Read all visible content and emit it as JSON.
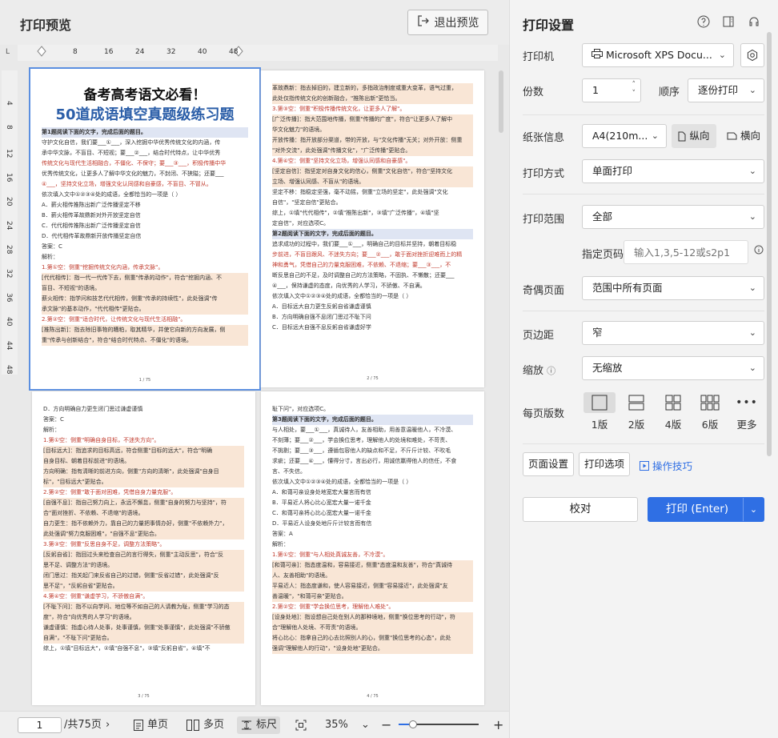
{
  "preview": {
    "title": "打印预览",
    "exit_label": "退出预览",
    "ruler_h": [
      "8",
      "16",
      "24",
      "32",
      "40",
      "48"
    ],
    "ruler_v": [
      "4",
      "8",
      "12",
      "16",
      "20",
      "24",
      "28",
      "32",
      "36",
      "40",
      "44",
      "48"
    ],
    "corner": "L",
    "page1": {
      "title1": "备考高考语文必看！",
      "title2": "50道成语填空真题级练习题",
      "lines": [
        {
          "t": "第1题阅读下面的文字，完成后面的题目。",
          "c": "b"
        },
        {
          "t": "守护文化自信，我们要___①___，深入挖掘中华优秀传统文化的内涵，传",
          "c": ""
        },
        {
          "t": "承中华文脉，不盲目、不短视；要___②___，结合时代特点，让中华优秀",
          "c": ""
        },
        {
          "t": "传统文化与现代生活相融合，不僵化、不保守；要___③___，积极传播中华",
          "c": "r"
        },
        {
          "t": "优秀传统文化，让更多人了解中华文化的魅力，不封闭、不狭隘；还要___",
          "c": ""
        },
        {
          "t": "④___，坚持文化立场，增强文化认同感和自豪感，不盲目、不冒从。",
          "c": "r"
        },
        {
          "t": "依次填入文中①②③④处的成语，全都恰当的一项是（ ）",
          "c": ""
        },
        {
          "t": "A．薪火相传推陈出新广泛传播坚定不移",
          "c": ""
        },
        {
          "t": "B．薪火相传革故鼎新对外开放坚定自信",
          "c": ""
        },
        {
          "t": "C．代代相传推陈出新广泛传播坚定自信",
          "c": ""
        },
        {
          "t": "D．代代相传革故鼎新开放传播坚定自信",
          "c": ""
        },
        {
          "t": "答案：C",
          "c": ""
        },
        {
          "t": "解析：",
          "c": ""
        },
        {
          "t": "1.第①空：侧重\"挖掘传统文化内涵，传承文脉\"。",
          "c": "r"
        },
        {
          "t": "[代代相传]：指一代一代传下去，侧重\"传承的动作\"，符合\"挖掘内涵、不",
          "c": "h"
        },
        {
          "t": "盲目、不短视\"的语境。",
          "c": "h"
        },
        {
          "t": "薪火相传：指学问和技艺代代相传，侧重\"传承的持续性\"，此处强调\"传",
          "c": "h"
        },
        {
          "t": "承文脉\"的基本动作，\"代代相传\"更贴合。",
          "c": "h"
        },
        {
          "t": "2.第②空：侧重\"适合时代，让传统文化与现代生活相融\"。",
          "c": "r"
        },
        {
          "t": "[推陈出新]：指去除旧事物的糟粕，取其精华，并使它向新的方向发展，侧",
          "c": "h"
        },
        {
          "t": "重\"传承与创新结合\"，符合\"结合时代特点、不僵化\"的语境。",
          "c": "h"
        }
      ],
      "pnum": "1 / 75"
    },
    "page2": {
      "lines": [
        {
          "t": "革故鼎新：指去掉旧的，建立新的，多指政治制度或重大变革，语气过重，",
          "c": "h"
        },
        {
          "t": "此处仅指传统文化的创新融合，\"推陈出新\"更恰当。",
          "c": "h"
        },
        {
          "t": "3.第③空：侧重\"积极传播传统文化，让更多人了解\"。",
          "c": "r"
        },
        {
          "t": "[广泛传播]：指大范围地传播，侧重\"传播的广度\"，符合\"让更多人了解中",
          "c": "h"
        },
        {
          "t": "华文化魅力\"的语境。",
          "c": "h"
        },
        {
          "t": "开放传播：指开放部分渠道，带的开放，与\"文化传播\"无关；对外开放：侧重",
          "c": "h"
        },
        {
          "t": "\"对外交流\"，此处强调\"传播文化\"，\"广泛传播\"更贴合。",
          "c": "h"
        },
        {
          "t": "4.第④空：侧重\"坚持文化立场，增强认同感和自豪感\"。",
          "c": "r"
        },
        {
          "t": "[坚定自信]：指坚定对自身文化的信心，侧重\"文化自信\"，符合\"坚持文化",
          "c": "h"
        },
        {
          "t": "立场、增强认同感、不盲从\"的语境。",
          "c": "h"
        },
        {
          "t": "坚定不移：指稳定坚强，毫不动摇，侧重\"立场的坚定\"，此处强调\"文化",
          "c": ""
        },
        {
          "t": "自信\"，\"坚定自信\"更贴合。",
          "c": ""
        },
        {
          "t": "综上，①填\"代代相传\"，②填\"推陈出新\"，③填\"广泛传播\"，④填\"坚",
          "c": ""
        },
        {
          "t": "定自信\"，对应选项C。",
          "c": ""
        },
        {
          "t": "第2题阅读下面的文字，完成后面的题目。",
          "c": "b"
        },
        {
          "t": "追求成功的过程中，我们要___①___，明确自己的目标并坚持，朝着目标稳",
          "c": ""
        },
        {
          "t": "步前进，不盲目跟风、不迷失方向；要___②___，敢于面对挫折迎难而上的精",
          "c": "r"
        },
        {
          "t": "神和勇气，凭借自己的力量克服困难，不依赖、不退缩；要___③___，不",
          "c": "r"
        },
        {
          "t": "断反思自己的不足，及时调整自己的方法策略，不固执、不懒散；还要___",
          "c": ""
        },
        {
          "t": "④___，保持谦虚的态度，向优秀的人学习，不骄傲、不自满。",
          "c": ""
        },
        {
          "t": "依次填入文中①②③④处的成语，全都恰当的一项是（ ）",
          "c": ""
        },
        {
          "t": "A．目标远大自力更生反躬自省谦虚谨慎",
          "c": ""
        },
        {
          "t": "B．方向明确自强不息闭门思过不耻下问",
          "c": ""
        },
        {
          "t": "C．目标远大自强不息反躬自省谦虚好学",
          "c": ""
        }
      ],
      "pnum": "2 / 75"
    },
    "page3": {
      "lines": [
        {
          "t": "D．方向明确自力更生闭门思过谦虚谨慎",
          "c": ""
        },
        {
          "t": "答案：C",
          "c": ""
        },
        {
          "t": "解析：",
          "c": ""
        },
        {
          "t": "1.第①空：侧重\"明确自身目标，不迷失方向\"。",
          "c": "r"
        },
        {
          "t": "[目标远大]：指追求的目标高远，符合侧重\"目标的远大\"，符合\"明确",
          "c": "h"
        },
        {
          "t": "自身目标、朝着目标前进\"的语境。",
          "c": "h"
        },
        {
          "t": "方向明确：指有清晰的前进方向，侧重\"方向的清晰\"，此处强调\"自身目",
          "c": "h"
        },
        {
          "t": "标\"，\"目标远大\"更贴合。",
          "c": "h"
        },
        {
          "t": "2.第②空：侧重\"敢于面对困难，凭借自身力量克服\"。",
          "c": "r"
        },
        {
          "t": "[自强不息]：指自己努力向上，永远不懈怠，侧重\"自身的努力与坚持\"，符",
          "c": "h"
        },
        {
          "t": "合\"面对挫折、不依赖、不退缩\"的语境。",
          "c": "h"
        },
        {
          "t": "自力更生：指不依赖外力，靠自己的力量把事情办好，侧重\"不依赖外力\"，",
          "c": "h"
        },
        {
          "t": "此处强调\"努力克服困难\"，\"自强不息\"更贴合。",
          "c": "h"
        },
        {
          "t": "3.第③空：侧重\"反思自身不足，调整方法策略\"。",
          "c": "r"
        },
        {
          "t": "[反躬自省]：指回过头来检查自己的言行得失，侧重\"主动反思\"，符合\"反",
          "c": "h"
        },
        {
          "t": "思不足、调整方法\"的语境。",
          "c": "h"
        },
        {
          "t": "闭门思过：指关起门来反省自己的过错，侧重\"反省过错\"，此处强调\"反",
          "c": "h"
        },
        {
          "t": "思不足\"，\"反躬自省\"更贴合。",
          "c": "h"
        },
        {
          "t": "4.第④空：侧重\"谦虚学习，不骄傲自满\"。",
          "c": "r"
        },
        {
          "t": "[不耻下问]：指不以向学问、地位等不如自己的人请教为耻，侧重\"学习的态",
          "c": "h"
        },
        {
          "t": "度\"，符合\"向优秀的人学习\"的语境。",
          "c": "h"
        },
        {
          "t": "谦虚谨慎：指虚心待人处事，处事谨慎，侧重\"处事谨慎\"，此处强调\"不骄傲",
          "c": "h"
        },
        {
          "t": "自满\"，\"不耻下问\"更贴合。",
          "c": "h"
        },
        {
          "t": "综上，①填\"目标远大\"，②填\"自强不息\"，③填\"反躬自省\"，④填\"不",
          "c": ""
        }
      ],
      "pnum": "3 / 75"
    },
    "page4": {
      "lines": [
        {
          "t": "耻下问\"，对应选项C。",
          "c": ""
        },
        {
          "t": "第3题阅读下面的文字，完成后面的题目。",
          "c": "b"
        },
        {
          "t": "与人相处，要___①___，真诚待人，友善相助，用善意温暖他人，不冷漠、",
          "c": ""
        },
        {
          "t": "不刻薄；要___②___，学会换位思考，理解他人的处境和难处，不苛责、",
          "c": ""
        },
        {
          "t": "不挑剔；要___③___，遵循包容他人的缺点和不足，不斤斤计较、不吹毛",
          "c": ""
        },
        {
          "t": "求疵；还要___④___，懂得分寸，言出必行，用诚信赢得他人的信任，不食",
          "c": ""
        },
        {
          "t": "言、不失信。",
          "c": ""
        },
        {
          "t": "依次填入文中①②③④处的成语，全都恰当的一项是（ ）",
          "c": ""
        },
        {
          "t": "A．和蔼可亲设身处地宽宏大量言而有信",
          "c": ""
        },
        {
          "t": "B．平易近人将心比心宽宏大量一诺千金",
          "c": ""
        },
        {
          "t": "C．和蔼可亲将心比心宽宏大量一诺千金",
          "c": ""
        },
        {
          "t": "D．平易近人设身处地斤斤计较言而有信",
          "c": ""
        },
        {
          "t": "答案：A",
          "c": ""
        },
        {
          "t": "解析：",
          "c": ""
        },
        {
          "t": "1.第①空：侧重\"与人相处真诚友善，不冷漠\"。",
          "c": "r"
        },
        {
          "t": "[和蔼可亲]：指态度温和，容易接近，侧重\"态度温和友善\"，符合\"真诚待",
          "c": "h"
        },
        {
          "t": "人、友善相助\"的语境。",
          "c": "h"
        },
        {
          "t": "平易近人：指态度谦和，使人容易接近，侧重\"容易接近\"，此处强调\"友",
          "c": "h"
        },
        {
          "t": "善温暖\"，\"和蔼可亲\"更贴合。",
          "c": "h"
        },
        {
          "t": "2.第②空：侧重\"学会换位思考，理解他人难处\"。",
          "c": "r"
        },
        {
          "t": "[设身处地]：指设想自己处在别人的那种境地，侧重\"换位思考的行动\"，符",
          "c": "h"
        },
        {
          "t": "合\"理解他人处境、不苛责\"的语境。",
          "c": "h"
        },
        {
          "t": "将心比心：指拿自己的心去比照别人的心，侧重\"换位思考的心态\"，此处",
          "c": "h"
        },
        {
          "t": "强调\"理解他人的行动\"，\"设身处地\"更贴合。",
          "c": "h"
        }
      ],
      "pnum": "4 / 75"
    }
  },
  "bottom": {
    "page_value": "1",
    "total": "/共75页",
    "single": "单页",
    "multi": "多页",
    "ruler": "标尺",
    "zoom": "35%",
    "zoom_fraction": 0.35
  },
  "settings": {
    "title": "打印设置",
    "printer_label": "打印机",
    "printer_value": "Microsoft XPS Docu...",
    "copies_label": "份数",
    "copies_value": "1",
    "order_label": "顺序",
    "order_value": "逐份打印",
    "paper_label": "纸张信息",
    "paper_value": "A4(210m...",
    "portrait": "纵向",
    "landscape": "横向",
    "mode_label": "打印方式",
    "mode_value": "单面打印",
    "range_label": "打印范围",
    "range_value": "全部",
    "pages_label": "指定页码",
    "pages_placeholder": "输入1,3,5-12或s2p1",
    "oddeven_label": "奇偶页面",
    "oddeven_value": "范围中所有页面",
    "margin_label": "页边距",
    "margin_value": "窄",
    "scale_label": "缩放",
    "scale_value": "无缩放",
    "perpage_label": "每页版数",
    "layouts": [
      "1版",
      "2版",
      "4版",
      "6版",
      "更多"
    ],
    "page_setup": "页面设置",
    "print_options": "打印选项",
    "tips": "操作技巧",
    "proof": "校对",
    "print": "打印 (Enter)"
  }
}
